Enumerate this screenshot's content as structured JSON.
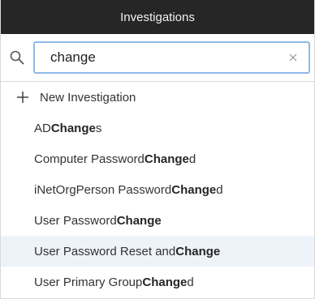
{
  "header": {
    "title": "Investigations"
  },
  "search": {
    "value": "change",
    "placeholder": ""
  },
  "new_item": {
    "label": "New Investigation"
  },
  "items": [
    {
      "pre": "AD ",
      "match": "Change",
      "post": "s"
    },
    {
      "pre": "Computer Password ",
      "match": "Change",
      "post": "d"
    },
    {
      "pre": "iNetOrgPerson Password ",
      "match": "Change",
      "post": "d"
    },
    {
      "pre": "User Password ",
      "match": "Change",
      "post": ""
    },
    {
      "pre": "User Password Reset and ",
      "match": "Change",
      "post": ""
    },
    {
      "pre": "User Primary Group ",
      "match": "Change",
      "post": "d"
    }
  ],
  "colors": {
    "header_bg": "#262626",
    "search_border": "#8fb9e5",
    "highlight_bg": "#eef3fa"
  },
  "icons": [
    "search-icon",
    "clear-icon",
    "plus-icon"
  ]
}
